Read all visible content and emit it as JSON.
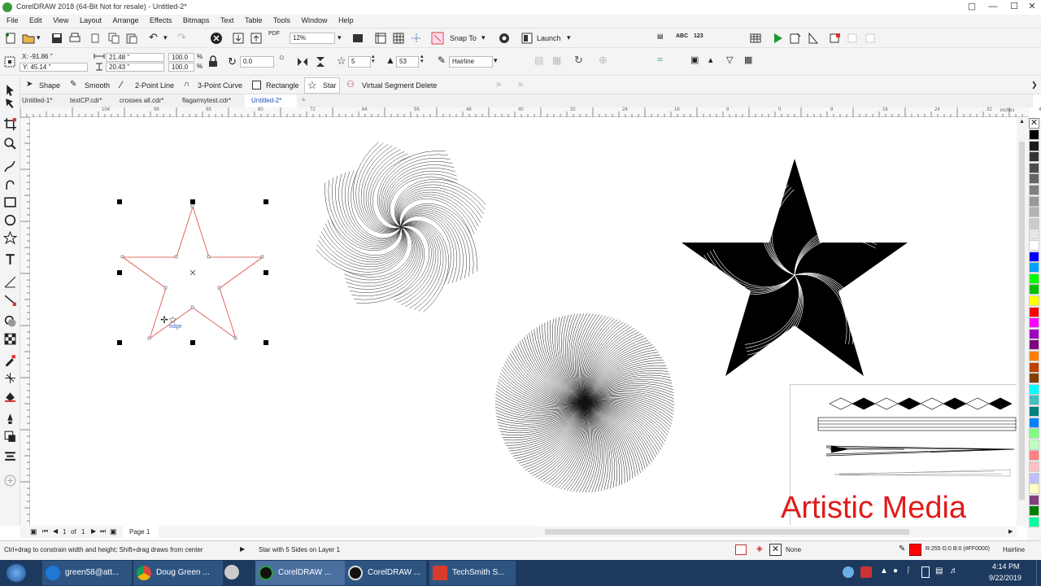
{
  "app": {
    "title": "CorelDRAW 2018 (64-Bit Not for resale) - Untitled-2*"
  },
  "window_controls": {
    "minimize": "—",
    "maximize": "☐",
    "close": "✕"
  },
  "menu": [
    "File",
    "Edit",
    "View",
    "Layout",
    "Arrange",
    "Effects",
    "Bitmaps",
    "Text",
    "Table",
    "Tools",
    "Window",
    "Help"
  ],
  "standard_toolbar": {
    "zoom_value": "12%",
    "snap_to_label": "Snap To",
    "launch_label": "Launch"
  },
  "property_bar": {
    "x": "X: -91.86 \"",
    "y": "Y: 45.14 \"",
    "width": "21.48 \"",
    "height": "20.43 \"",
    "scale_w": "100.0",
    "scale_h": "100.0",
    "percent_sign": "%",
    "rotation": "0.0",
    "points": "5",
    "sharpness": "53",
    "outline": "Hairline"
  },
  "shape_toolbar": {
    "items": [
      "Shape",
      "Smooth",
      "2-Point Line",
      "3-Point Curve",
      "Rectangle",
      "Star",
      "Virtual Segment Delete"
    ]
  },
  "document_tabs": [
    "Untitled-1*",
    "textCP.cdr*",
    "crosses all.cdr*",
    "flagarmytest.cdr*",
    "Untitled-2*"
  ],
  "ruler": {
    "unit": "inches",
    "top_labels": [
      "104",
      "96",
      "88",
      "80",
      "72",
      "64",
      "56",
      "48",
      "40",
      "32",
      "24",
      "16",
      "8",
      "0",
      "8",
      "16",
      "24",
      "32",
      "40"
    ]
  },
  "canvas": {
    "cursor_hint": "edge",
    "artistic_media_text": "Artistic Media"
  },
  "page_nav": {
    "current": "1",
    "of_label": "of",
    "total": "1",
    "page_tab": "Page 1"
  },
  "status": {
    "hint": "Ctrl+drag to constrain width and height; Shift+drag draws from center",
    "object_info": "Star with 5 Sides on Layer 1",
    "fill_label": "None",
    "outline_color": "R:255 G:0 B:0 (#FF0000)",
    "outline_width": "Hairline"
  },
  "taskbar": {
    "items": [
      {
        "label": "green58@att...",
        "icon_color": "#1e78d6"
      },
      {
        "label": "Doug Green ...",
        "icon_color": "#db4437"
      },
      {
        "label": "CorelDRAW ...",
        "icon_color": "#2a9d3b"
      },
      {
        "label": "CorelDRAW ...",
        "icon_color": "#2a9d3b"
      },
      {
        "label": "TechSmith S...",
        "icon_color": "#d93c2b"
      }
    ],
    "time": "4:14 PM",
    "date": "9/22/2019"
  },
  "colors": {
    "selection_outline": "#d9453b",
    "artistic_text": "#e01b1b",
    "taskbar_bg": "#1d3a5e",
    "palette": [
      "#000000",
      "#1a1a1a",
      "#333333",
      "#4d4d4d",
      "#666666",
      "#808080",
      "#999999",
      "#b3b3b3",
      "#cccccc",
      "#e6e6e6",
      "#ffffff",
      "#0000ff",
      "#00a0ff",
      "#00ff00",
      "#00c000",
      "#ffff00",
      "#ff0000",
      "#ff00ff",
      "#a000c0",
      "#800080",
      "#ff8000",
      "#c04000",
      "#804000",
      "#00ffff",
      "#40c0c0",
      "#008080",
      "#0080ff",
      "#80ff80",
      "#c0ffc0",
      "#ff8080",
      "#ffc0c0",
      "#c0c0ff",
      "#ffffc0",
      "#804080",
      "#008000",
      "#00ffa0"
    ]
  }
}
